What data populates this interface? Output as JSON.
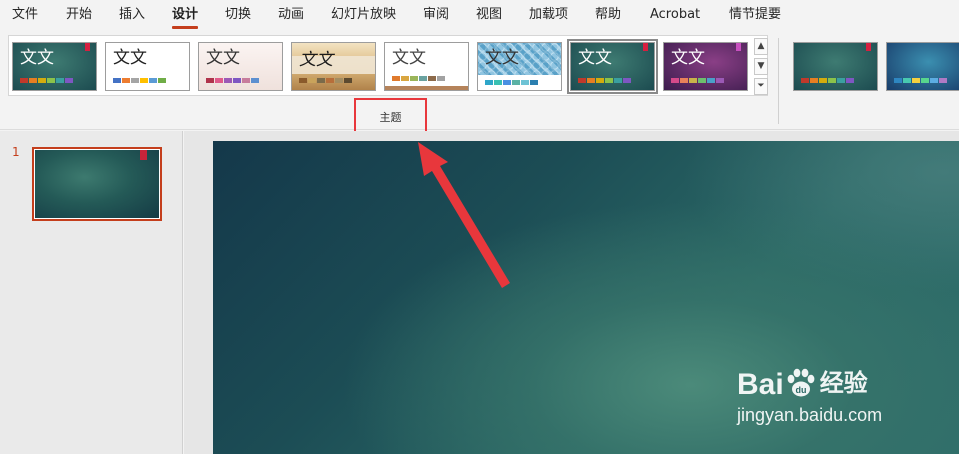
{
  "tabs": [
    {
      "label": "文件"
    },
    {
      "label": "开始"
    },
    {
      "label": "插入"
    },
    {
      "label": "设计"
    },
    {
      "label": "切换"
    },
    {
      "label": "动画"
    },
    {
      "label": "幻灯片放映"
    },
    {
      "label": "审阅"
    },
    {
      "label": "视图"
    },
    {
      "label": "加载项"
    },
    {
      "label": "帮助"
    },
    {
      "label": "Acrobat"
    },
    {
      "label": "情节提要"
    }
  ],
  "active_tab": "设计",
  "themes": {
    "group_label": "主题",
    "sample_word": "文文",
    "items": [
      {
        "name": "teal-dark-theme",
        "selected": false
      },
      {
        "name": "office-theme",
        "selected": false
      },
      {
        "name": "light-gradient-theme",
        "selected": false
      },
      {
        "name": "ink-brush-theme",
        "selected": false
      },
      {
        "name": "retrospect-theme",
        "selected": false
      },
      {
        "name": "pattern-blue-theme",
        "selected": false
      },
      {
        "name": "teal-dark-selected-theme",
        "selected": true
      },
      {
        "name": "purple-theme",
        "selected": false
      }
    ]
  },
  "variants": [
    {
      "name": "teal-variant"
    },
    {
      "name": "blue-variant"
    }
  ],
  "slides": [
    {
      "number": "1"
    }
  ],
  "watermark": {
    "logo_text": "Bai",
    "logo_text2": "经验",
    "url": "jingyan.baidu.com"
  },
  "colors": {
    "accent": "#c43e1c",
    "annotation_red": "#e8373c",
    "slide_teal": "#2b6966"
  }
}
